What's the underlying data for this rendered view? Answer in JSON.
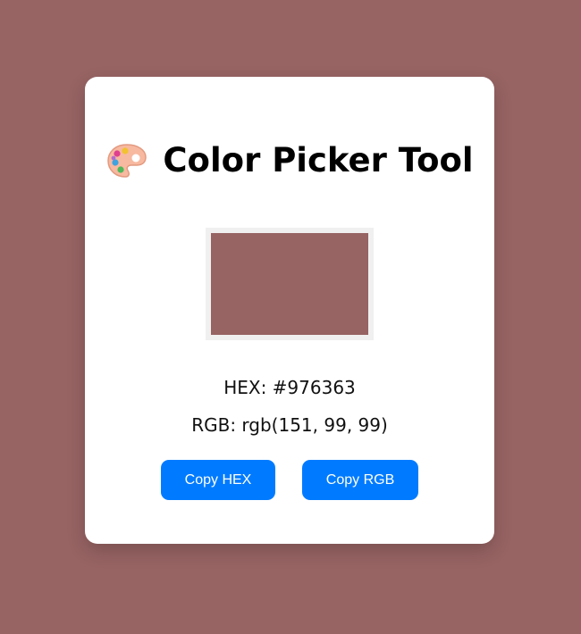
{
  "page": {
    "background": "#976363"
  },
  "card": {
    "title": "Color Picker Tool",
    "title_icon": "artist-palette-icon"
  },
  "swatch": {
    "color": "#976363",
    "border_color": "#f0f0f0"
  },
  "values": {
    "hex_text": "HEX: #976363",
    "rgb_text": "RGB: rgb(151, 99, 99)"
  },
  "buttons": {
    "copy_hex_label": "Copy HEX",
    "copy_rgb_label": "Copy RGB",
    "color": "#007bff"
  }
}
